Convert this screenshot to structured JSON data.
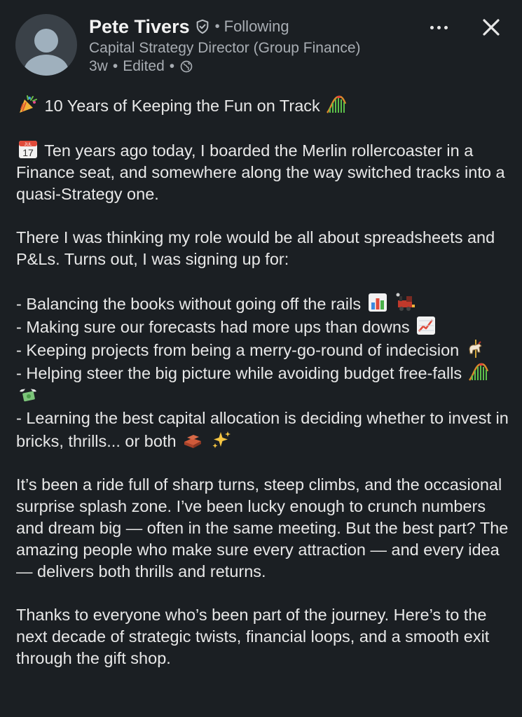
{
  "author": {
    "name": "Pete Tivers",
    "following_label": "Following",
    "separator": "•",
    "headline": "Capital Strategy Director (Group Finance)",
    "time": "3w",
    "edited_label": "Edited"
  },
  "icons": {
    "verified": "verified-shield-icon",
    "visibility": "globe-icon",
    "more": "more-options-icon",
    "close": "close-icon"
  },
  "post": {
    "title": "10 Years of Keeping the Fun on Track",
    "calendar_emoji_label": "JUL",
    "calendar_emoji_day": "17",
    "intro": "Ten years ago today, I boarded the Merlin rollercoaster in a Finance seat, and somewhere along the way switched tracks into a quasi-Strategy one.",
    "paragraph2": "There I was thinking my role would be all about spreadsheets and P&Ls. Turns out, I was signing up for:",
    "bullets": [
      "- Balancing the books without going off the rails",
      "- Making sure our forecasts had more ups than downs",
      "- Keeping projects from being a merry-go-round of indecision",
      "- Helping steer the big picture while avoiding budget free-falls",
      "- Learning the best capital allocation is deciding whether to invest in bricks, thrills... or both"
    ],
    "paragraph3": "It’s been a ride full of sharp turns, steep climbs, and the occasional surprise splash zone. I’ve been lucky enough to crunch numbers and dream big — often in the same meeting. But the best part? The amazing people who make sure every attraction — and every idea — delivers both thrills and returns.",
    "paragraph4": "Thanks to everyone who’s been part of the journey. Here’s to the next decade of strategic twists, financial loops, and a smooth exit through the gift shop."
  },
  "colors": {
    "background": "#1b1f23",
    "text_primary": "#e8e8e8",
    "text_secondary": "#a8adb3"
  }
}
